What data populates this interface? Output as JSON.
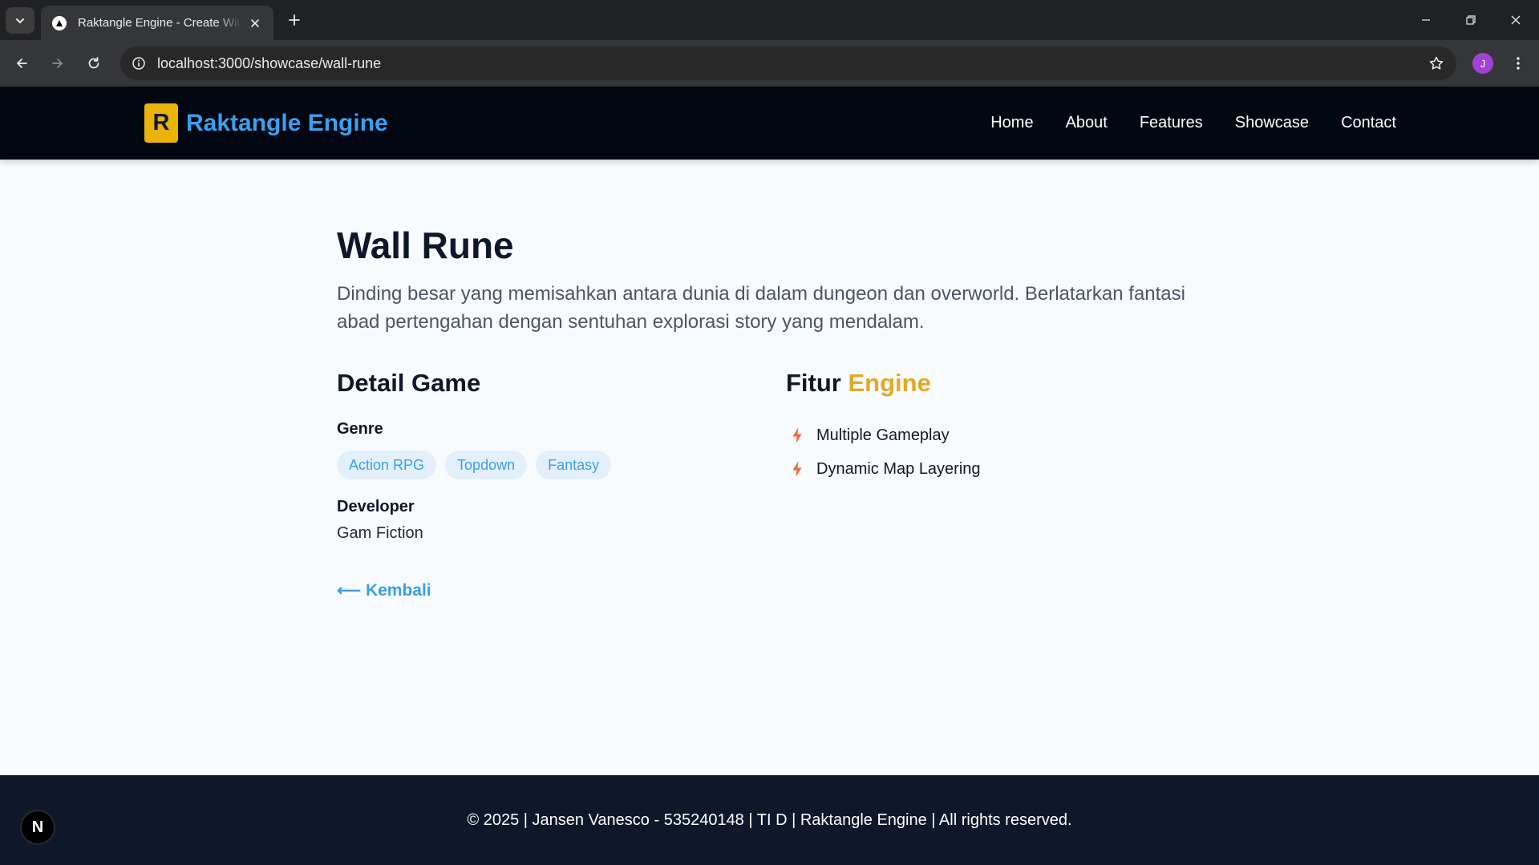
{
  "browser": {
    "tab_title": "Raktangle Engine - Create With Raktangle",
    "url": "localhost:3000/showcase/wall-rune",
    "profile_initial": "J"
  },
  "site": {
    "logo_letter": "R",
    "brand_name": "Raktangle Engine",
    "nav": [
      "Home",
      "About",
      "Features",
      "Showcase",
      "Contact"
    ]
  },
  "game": {
    "title": "Wall Rune",
    "description": "Dinding besar yang memisahkan antara dunia di dalam dungeon dan overworld. Berlatarkan fantasi abad pertengahan dengan sentuhan explorasi story yang mendalam.",
    "detail_heading": "Detail Game",
    "genre_label": "Genre",
    "genres": [
      "Action RPG",
      "Topdown",
      "Fantasy"
    ],
    "developer_label": "Developer",
    "developer": "Gam Fiction",
    "back_link": "⟵ Kembali",
    "features_heading_prefix": "Fitur",
    "features_heading_accent": "Engine",
    "features": [
      "Multiple Gameplay",
      "Dynamic Map Layering"
    ]
  },
  "footer": {
    "text": "© 2025 | Jansen Vanesco - 535240148 | TI D | Raktangle Engine | All rights reserved."
  },
  "dev_badge": "N",
  "colors": {
    "brand_blue": "#3ba0ee",
    "logo_yellow": "#eab308",
    "accent_gold": "#e0aa25",
    "bolt_orange": "#f26b3a",
    "header_bg": "#030712",
    "footer_bg": "#0f172a"
  },
  "icons": [
    "tab-search-icon",
    "close-icon",
    "plus-icon",
    "minimize-icon",
    "restore-icon",
    "back-arrow-icon",
    "forward-arrow-icon",
    "reload-icon",
    "info-icon",
    "star-icon",
    "kebab-menu-icon",
    "lightning-bolt-icon"
  ]
}
